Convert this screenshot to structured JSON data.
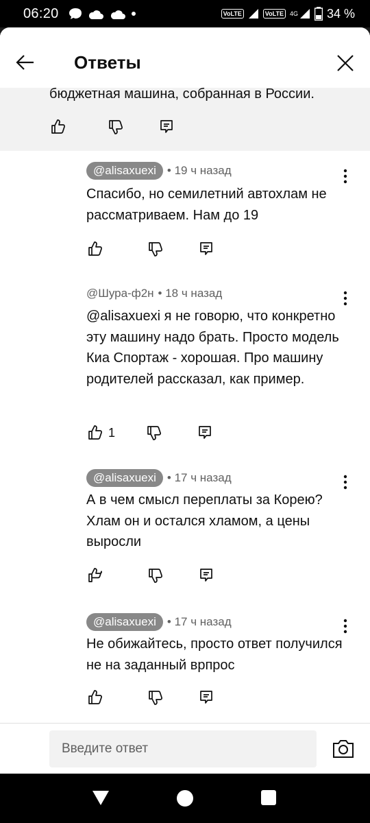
{
  "status_bar": {
    "time": "06:20",
    "volte1": "VoLTE",
    "volte2": "VoLTE",
    "network": "4G",
    "battery": "34 %"
  },
  "header": {
    "title": "Ответы"
  },
  "parent_comment": {
    "text_tail": "бюджетная машина, собранная в России."
  },
  "replies": [
    {
      "author": "@alisaxuexi",
      "time": "• 19 ч назад",
      "text": "Спасибо, но семилетний автохлам не рассматриваем. Нам до 19",
      "likes": ""
    },
    {
      "author": "@Шура-ф2н",
      "time": "• 18 ч назад",
      "text": "@alisaxuexi  я не говорю, что конкретно эту машину надо брать. Просто модель Киа Спортаж - хорошая. Про машину родителей рассказал, как пример.",
      "likes": "1"
    },
    {
      "author": "@alisaxuexi",
      "time": "• 17 ч назад",
      "text": "А в чем смысл переплаты за Корею? Хлам он и остался хламом, а цены выросли",
      "likes": ""
    },
    {
      "author": "@alisaxuexi",
      "time": "• 17 ч назад",
      "text": "Не обижайтесь, просто ответ получился не на заданный врпрос",
      "likes": ""
    }
  ],
  "input": {
    "placeholder": "Введите ответ"
  },
  "icons": {
    "back": "arrow-left-icon",
    "close": "close-icon",
    "like": "thumbs-up-icon",
    "dislike": "thumbs-down-icon",
    "reply": "reply-icon",
    "more": "more-vertical-icon",
    "camera": "camera-icon"
  },
  "colors": {
    "author_chip": "#888888",
    "meta_text": "#606060",
    "parent_bg": "#f2f2f2"
  }
}
